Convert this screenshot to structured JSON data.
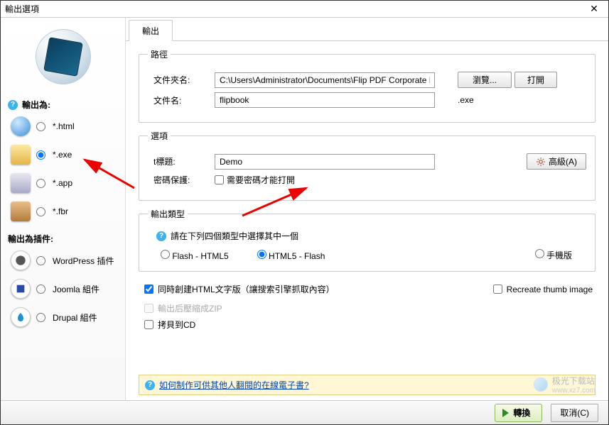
{
  "window": {
    "title": "輸出選項"
  },
  "sidebar": {
    "output_as_label": "輸出為:",
    "formats": [
      {
        "label": "*.html",
        "checked": false
      },
      {
        "label": "*.exe",
        "checked": true
      },
      {
        "label": "*.app",
        "checked": false
      },
      {
        "label": "*.fbr",
        "checked": false
      }
    ],
    "plugins_label": "輸出為插件:",
    "plugins": [
      {
        "label": "WordPress 插件"
      },
      {
        "label": "Joomla 組件"
      },
      {
        "label": "Drupal 組件"
      }
    ]
  },
  "tabs": {
    "output": "輸出"
  },
  "path_group": {
    "legend": "路徑",
    "folder_label": "文件夾名:",
    "folder_value": "C:\\Users\\Administrator\\Documents\\Flip PDF Corporate Edition\\",
    "browse_btn": "瀏覽...",
    "open_btn": "打開",
    "file_label": "文件名:",
    "file_value": "flipbook",
    "ext": ".exe"
  },
  "options_group": {
    "legend": "選項",
    "title_label": "t標題:",
    "title_value": "Demo",
    "advanced_btn": "高級(A)",
    "pw_label": "密碼保護:",
    "pw_check": "需要密碼才能打開"
  },
  "type_group": {
    "legend": "輸出類型",
    "hint": "請在下列四個類型中選擇其中一個",
    "opt_flash_html5": "Flash - HTML5",
    "opt_html5_flash": "HTML5 - Flash",
    "opt_mobile": "手機版"
  },
  "checks": {
    "create_html": "同時創建HTML文字版（讓搜索引擎抓取內容）",
    "recreate_thumb": "Recreate thumb image",
    "zip": "輸出后壓縮成ZIP",
    "copy_cd": "拷貝到CD"
  },
  "help": {
    "link": "如何制作可供其他人翻閱的在線電子書?"
  },
  "footer": {
    "convert": "轉換",
    "cancel": "取消(C)"
  },
  "watermark": {
    "text": "极光下载站",
    "url": "www.xz7.com"
  }
}
